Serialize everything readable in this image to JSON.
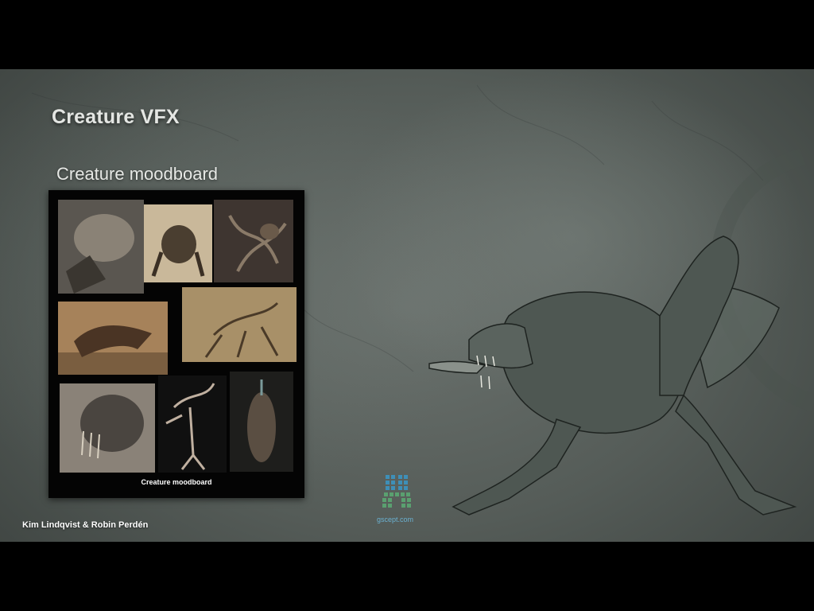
{
  "slide": {
    "title": "Creature VFX",
    "subtitle": "Creature moodboard"
  },
  "moodboard": {
    "caption": "Creature moodboard",
    "tiles": [
      "creature-head-concept",
      "hunched-creature-concept",
      "tentacle-creature-concept",
      "leaping-creature-concept",
      "long-limbed-creature-concept",
      "fanged-creature-head-concept",
      "contorted-figure-concept",
      "sculpted-creature-concept"
    ]
  },
  "artwork": {
    "main": "crouching-creature-illustration"
  },
  "footer": {
    "authors": "Kim Lindqvist & Robin Perdén",
    "logo_text": "gscept.com"
  },
  "colors": {
    "background": "#5f6662",
    "letterbox": "#000000",
    "title_text": "#e4e6e3",
    "logo_blue": "#3e8fb8",
    "logo_green": "#5aa070"
  }
}
